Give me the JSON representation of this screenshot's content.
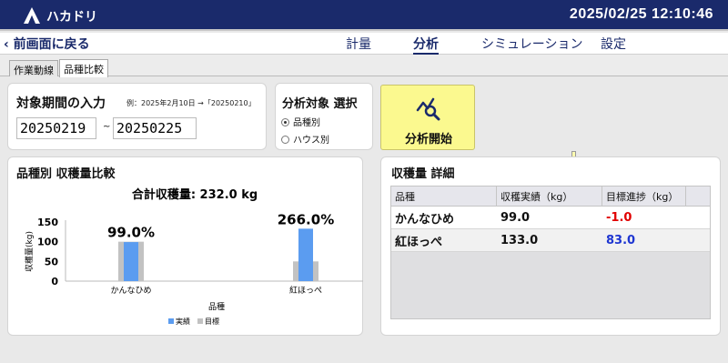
{
  "app": {
    "title": "ハカドリ",
    "clock": "2025/02/25 12:10:46"
  },
  "nav": {
    "back_label": "前画面に戻る",
    "tabs": [
      {
        "label": "計量",
        "active": false
      },
      {
        "label": "分析",
        "active": true
      },
      {
        "label": "シミュレーション",
        "active": false
      },
      {
        "label": "設定",
        "active": false
      }
    ]
  },
  "subtabs": [
    {
      "label": "作業動線",
      "active": false
    },
    {
      "label": "品種比較",
      "active": true
    }
  ],
  "period": {
    "label": "対象期間の入力",
    "example": "例：2025年2月10日 →「20250210」",
    "start": "20250219",
    "separator": "~",
    "end": "20250225"
  },
  "target": {
    "label": "分析対象 選択",
    "options": [
      {
        "label": "品種別",
        "selected": true
      },
      {
        "label": "ハウス別",
        "selected": false
      }
    ]
  },
  "start_button": {
    "label": "分析開始",
    "icon": "analytics-search-icon"
  },
  "chart_panel": {
    "title": "品種別 収穫量比較",
    "total_label": "合計収穫量: 232.0 kg"
  },
  "chart_data": {
    "type": "bar",
    "categories": [
      "かんなひめ",
      "紅ほっぺ"
    ],
    "series": [
      {
        "name": "実績",
        "values": [
          99.0,
          133.0
        ],
        "color": "#5b9cf0"
      },
      {
        "name": "目標",
        "values": [
          100.0,
          50.0
        ],
        "color": "#c2c2c2"
      }
    ],
    "data_labels": [
      "99.0%",
      "266.0%"
    ],
    "ylabel": "収穫量(kg)",
    "xlabel": "品種",
    "yticks": [
      0,
      50,
      100,
      150
    ],
    "ylim": [
      0,
      150
    ],
    "legend_position": "bottom-center"
  },
  "detail": {
    "title": "収穫量 詳細",
    "columns": [
      "品種",
      "収穫実績（kg）",
      "目標進捗（kg）"
    ],
    "rows": [
      {
        "variety": "かんなひめ",
        "actual": "99.0",
        "progress": "-1.0",
        "progress_color": "#e10000"
      },
      {
        "variety": "紅ほっぺ",
        "actual": "133.0",
        "progress": "83.0",
        "progress_color": "#1d35d1"
      }
    ]
  }
}
